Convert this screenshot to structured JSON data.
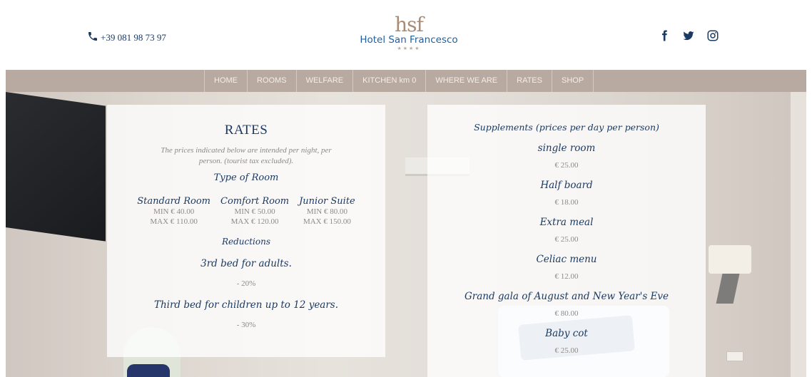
{
  "header": {
    "phone": "+39 081 98 73 97",
    "logo_mark": "hsf",
    "logo_name": "Hotel San Francesco",
    "logo_stars": "★★★★",
    "social": [
      "facebook-icon",
      "twitter-icon",
      "instagram-icon"
    ]
  },
  "nav": {
    "items": [
      "HOME",
      "ROOMS",
      "WELFARE",
      "KITCHEN km 0",
      "WHERE WE ARE",
      "RATES",
      "SHOP"
    ]
  },
  "rates": {
    "title": "RATES",
    "note": "The prices indicated below are intended per night, per person. (tourist tax excluded).",
    "type_title": "Type of Room",
    "rooms": [
      {
        "name": "Standard Room",
        "min": "MIN € 40.00",
        "max": "MAX € 110.00"
      },
      {
        "name": "Comfort Room",
        "min": "MIN € 50.00",
        "max": "MAX € 120.00"
      },
      {
        "name": "Junior Suite",
        "min": "MIN € 80.00",
        "max": "MAX € 150.00"
      }
    ],
    "reductions_title": "Reductions",
    "reductions": [
      {
        "label": "3rd bed for adults.",
        "value": "- 20%"
      },
      {
        "label": "Third bed for children up to 12 years.",
        "value": "- 30%"
      }
    ]
  },
  "supplements": {
    "title": "Supplements (prices per day per person)",
    "items": [
      {
        "label": "single room",
        "price": "€ 25.00"
      },
      {
        "label": "Half board",
        "price": "€ 18.00"
      },
      {
        "label": "Extra meal",
        "price": "€ 25.00"
      },
      {
        "label": "Celiac menu",
        "price": "€ 12.00"
      },
      {
        "label": "Grand gala of August and New Year's Eve",
        "price": "€ 80.00"
      },
      {
        "label": "Baby cot",
        "price": "€ 25.00"
      }
    ]
  },
  "colors": {
    "brand_navy": "#1a3a63",
    "brand_blue": "#1f5f9f",
    "nav_bg": "#b8aaa0",
    "logo_taupe": "#a88c78"
  }
}
